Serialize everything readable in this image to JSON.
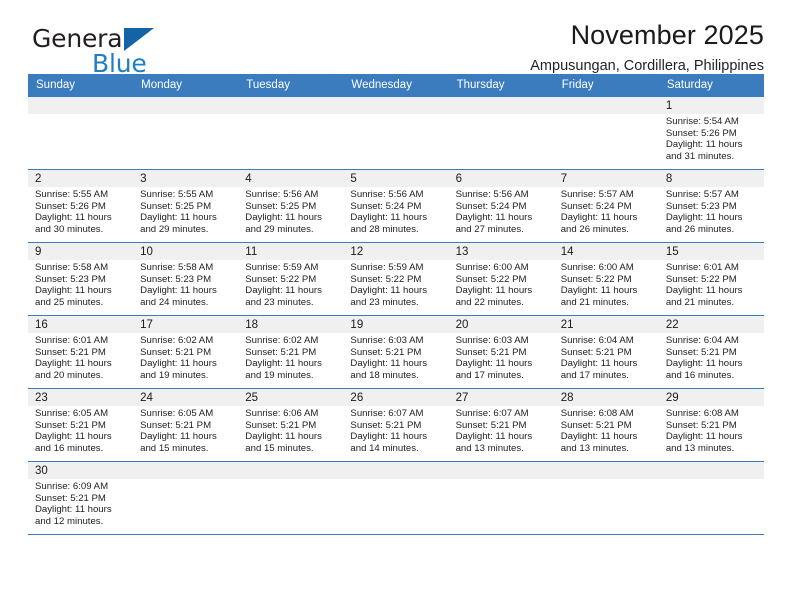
{
  "brand": {
    "name_top": "General",
    "name_bottom": "Blue",
    "triangle_color": "#1464a5",
    "blue_color": "#1e7fc4"
  },
  "header": {
    "title": "November 2025",
    "subtitle": "Ampusungan, Cordillera, Philippines"
  },
  "theme": {
    "header_row_bg": "#3a7cbe",
    "header_row_text": "#ffffff",
    "daynum_band_bg": "#f0f0f0",
    "row_border": "#3a7cbe",
    "cell_bg": "#ffffff",
    "body_text": "#1f1f1f"
  },
  "weekday_headers": [
    "Sunday",
    "Monday",
    "Tuesday",
    "Wednesday",
    "Thursday",
    "Friday",
    "Saturday"
  ],
  "labels": {
    "sunrise_prefix": "Sunrise:",
    "sunset_prefix": "Sunset:",
    "daylight_prefix": "Daylight:"
  },
  "weeks": [
    [
      {
        "empty": true
      },
      {
        "empty": true
      },
      {
        "empty": true
      },
      {
        "empty": true
      },
      {
        "empty": true
      },
      {
        "empty": true
      },
      {
        "day": "1",
        "sunrise": "Sunrise: 5:54 AM",
        "sunset": "Sunset: 5:26 PM",
        "daylight_l1": "Daylight: 11 hours",
        "daylight_l2": "and 31 minutes."
      }
    ],
    [
      {
        "day": "2",
        "sunrise": "Sunrise: 5:55 AM",
        "sunset": "Sunset: 5:26 PM",
        "daylight_l1": "Daylight: 11 hours",
        "daylight_l2": "and 30 minutes."
      },
      {
        "day": "3",
        "sunrise": "Sunrise: 5:55 AM",
        "sunset": "Sunset: 5:25 PM",
        "daylight_l1": "Daylight: 11 hours",
        "daylight_l2": "and 29 minutes."
      },
      {
        "day": "4",
        "sunrise": "Sunrise: 5:56 AM",
        "sunset": "Sunset: 5:25 PM",
        "daylight_l1": "Daylight: 11 hours",
        "daylight_l2": "and 29 minutes."
      },
      {
        "day": "5",
        "sunrise": "Sunrise: 5:56 AM",
        "sunset": "Sunset: 5:24 PM",
        "daylight_l1": "Daylight: 11 hours",
        "daylight_l2": "and 28 minutes."
      },
      {
        "day": "6",
        "sunrise": "Sunrise: 5:56 AM",
        "sunset": "Sunset: 5:24 PM",
        "daylight_l1": "Daylight: 11 hours",
        "daylight_l2": "and 27 minutes."
      },
      {
        "day": "7",
        "sunrise": "Sunrise: 5:57 AM",
        "sunset": "Sunset: 5:24 PM",
        "daylight_l1": "Daylight: 11 hours",
        "daylight_l2": "and 26 minutes."
      },
      {
        "day": "8",
        "sunrise": "Sunrise: 5:57 AM",
        "sunset": "Sunset: 5:23 PM",
        "daylight_l1": "Daylight: 11 hours",
        "daylight_l2": "and 26 minutes."
      }
    ],
    [
      {
        "day": "9",
        "sunrise": "Sunrise: 5:58 AM",
        "sunset": "Sunset: 5:23 PM",
        "daylight_l1": "Daylight: 11 hours",
        "daylight_l2": "and 25 minutes."
      },
      {
        "day": "10",
        "sunrise": "Sunrise: 5:58 AM",
        "sunset": "Sunset: 5:23 PM",
        "daylight_l1": "Daylight: 11 hours",
        "daylight_l2": "and 24 minutes."
      },
      {
        "day": "11",
        "sunrise": "Sunrise: 5:59 AM",
        "sunset": "Sunset: 5:22 PM",
        "daylight_l1": "Daylight: 11 hours",
        "daylight_l2": "and 23 minutes."
      },
      {
        "day": "12",
        "sunrise": "Sunrise: 5:59 AM",
        "sunset": "Sunset: 5:22 PM",
        "daylight_l1": "Daylight: 11 hours",
        "daylight_l2": "and 23 minutes."
      },
      {
        "day": "13",
        "sunrise": "Sunrise: 6:00 AM",
        "sunset": "Sunset: 5:22 PM",
        "daylight_l1": "Daylight: 11 hours",
        "daylight_l2": "and 22 minutes."
      },
      {
        "day": "14",
        "sunrise": "Sunrise: 6:00 AM",
        "sunset": "Sunset: 5:22 PM",
        "daylight_l1": "Daylight: 11 hours",
        "daylight_l2": "and 21 minutes."
      },
      {
        "day": "15",
        "sunrise": "Sunrise: 6:01 AM",
        "sunset": "Sunset: 5:22 PM",
        "daylight_l1": "Daylight: 11 hours",
        "daylight_l2": "and 21 minutes."
      }
    ],
    [
      {
        "day": "16",
        "sunrise": "Sunrise: 6:01 AM",
        "sunset": "Sunset: 5:21 PM",
        "daylight_l1": "Daylight: 11 hours",
        "daylight_l2": "and 20 minutes."
      },
      {
        "day": "17",
        "sunrise": "Sunrise: 6:02 AM",
        "sunset": "Sunset: 5:21 PM",
        "daylight_l1": "Daylight: 11 hours",
        "daylight_l2": "and 19 minutes."
      },
      {
        "day": "18",
        "sunrise": "Sunrise: 6:02 AM",
        "sunset": "Sunset: 5:21 PM",
        "daylight_l1": "Daylight: 11 hours",
        "daylight_l2": "and 19 minutes."
      },
      {
        "day": "19",
        "sunrise": "Sunrise: 6:03 AM",
        "sunset": "Sunset: 5:21 PM",
        "daylight_l1": "Daylight: 11 hours",
        "daylight_l2": "and 18 minutes."
      },
      {
        "day": "20",
        "sunrise": "Sunrise: 6:03 AM",
        "sunset": "Sunset: 5:21 PM",
        "daylight_l1": "Daylight: 11 hours",
        "daylight_l2": "and 17 minutes."
      },
      {
        "day": "21",
        "sunrise": "Sunrise: 6:04 AM",
        "sunset": "Sunset: 5:21 PM",
        "daylight_l1": "Daylight: 11 hours",
        "daylight_l2": "and 17 minutes."
      },
      {
        "day": "22",
        "sunrise": "Sunrise: 6:04 AM",
        "sunset": "Sunset: 5:21 PM",
        "daylight_l1": "Daylight: 11 hours",
        "daylight_l2": "and 16 minutes."
      }
    ],
    [
      {
        "day": "23",
        "sunrise": "Sunrise: 6:05 AM",
        "sunset": "Sunset: 5:21 PM",
        "daylight_l1": "Daylight: 11 hours",
        "daylight_l2": "and 16 minutes."
      },
      {
        "day": "24",
        "sunrise": "Sunrise: 6:05 AM",
        "sunset": "Sunset: 5:21 PM",
        "daylight_l1": "Daylight: 11 hours",
        "daylight_l2": "and 15 minutes."
      },
      {
        "day": "25",
        "sunrise": "Sunrise: 6:06 AM",
        "sunset": "Sunset: 5:21 PM",
        "daylight_l1": "Daylight: 11 hours",
        "daylight_l2": "and 15 minutes."
      },
      {
        "day": "26",
        "sunrise": "Sunrise: 6:07 AM",
        "sunset": "Sunset: 5:21 PM",
        "daylight_l1": "Daylight: 11 hours",
        "daylight_l2": "and 14 minutes."
      },
      {
        "day": "27",
        "sunrise": "Sunrise: 6:07 AM",
        "sunset": "Sunset: 5:21 PM",
        "daylight_l1": "Daylight: 11 hours",
        "daylight_l2": "and 13 minutes."
      },
      {
        "day": "28",
        "sunrise": "Sunrise: 6:08 AM",
        "sunset": "Sunset: 5:21 PM",
        "daylight_l1": "Daylight: 11 hours",
        "daylight_l2": "and 13 minutes."
      },
      {
        "day": "29",
        "sunrise": "Sunrise: 6:08 AM",
        "sunset": "Sunset: 5:21 PM",
        "daylight_l1": "Daylight: 11 hours",
        "daylight_l2": "and 13 minutes."
      }
    ],
    [
      {
        "day": "30",
        "sunrise": "Sunrise: 6:09 AM",
        "sunset": "Sunset: 5:21 PM",
        "daylight_l1": "Daylight: 11 hours",
        "daylight_l2": "and 12 minutes."
      },
      {
        "empty": true
      },
      {
        "empty": true
      },
      {
        "empty": true
      },
      {
        "empty": true
      },
      {
        "empty": true
      },
      {
        "empty": true
      }
    ]
  ]
}
